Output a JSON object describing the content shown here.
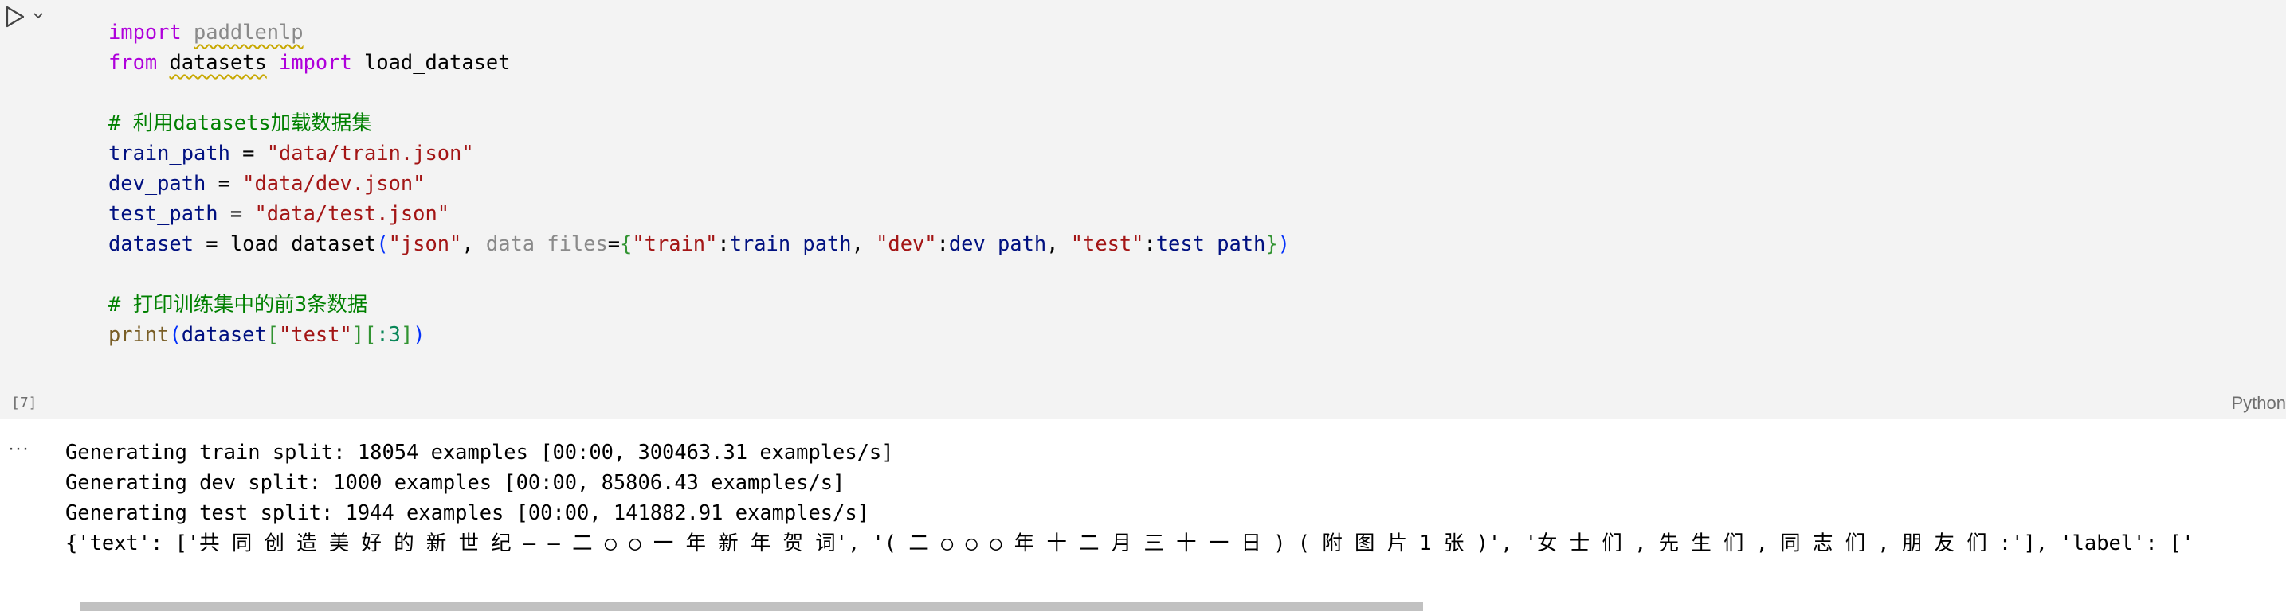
{
  "cell": {
    "execution_count": "[7]",
    "language": "Python",
    "code_lines": [
      [
        {
          "t": "import",
          "c": "kw"
        },
        {
          "t": " ",
          "c": ""
        },
        {
          "t": "paddlenlp",
          "c": "mod-unused"
        }
      ],
      [
        {
          "t": "from",
          "c": "kw"
        },
        {
          "t": " ",
          "c": ""
        },
        {
          "t": "datasets",
          "c": "mod-warn"
        },
        {
          "t": " ",
          "c": ""
        },
        {
          "t": "import",
          "c": "kw"
        },
        {
          "t": " load_dataset",
          "c": ""
        }
      ],
      [],
      [
        {
          "t": "# 利用datasets加载数据集",
          "c": "cmt"
        }
      ],
      [
        {
          "t": "train_path",
          "c": "var"
        },
        {
          "t": " = ",
          "c": ""
        },
        {
          "t": "\"data/train.json\"",
          "c": "str"
        }
      ],
      [
        {
          "t": "dev_path",
          "c": "var"
        },
        {
          "t": " = ",
          "c": ""
        },
        {
          "t": "\"data/dev.json\"",
          "c": "str"
        }
      ],
      [
        {
          "t": "test_path",
          "c": "var"
        },
        {
          "t": " = ",
          "c": ""
        },
        {
          "t": "\"data/test.json\"",
          "c": "str"
        }
      ],
      [
        {
          "t": "dataset",
          "c": "var"
        },
        {
          "t": " = ",
          "c": ""
        },
        {
          "t": "load_dataset",
          "c": ""
        },
        {
          "t": "(",
          "c": "br1"
        },
        {
          "t": "\"json\"",
          "c": "str"
        },
        {
          "t": ", ",
          "c": ""
        },
        {
          "t": "data_files",
          "c": "param"
        },
        {
          "t": "=",
          "c": ""
        },
        {
          "t": "{",
          "c": "br2"
        },
        {
          "t": "\"train\"",
          "c": "str"
        },
        {
          "t": ":",
          "c": ""
        },
        {
          "t": "train_path",
          "c": "var"
        },
        {
          "t": ", ",
          "c": ""
        },
        {
          "t": "\"dev\"",
          "c": "str"
        },
        {
          "t": ":",
          "c": ""
        },
        {
          "t": "dev_path",
          "c": "var"
        },
        {
          "t": ", ",
          "c": ""
        },
        {
          "t": "\"test\"",
          "c": "str"
        },
        {
          "t": ":",
          "c": ""
        },
        {
          "t": "test_path",
          "c": "var"
        },
        {
          "t": "}",
          "c": "br2"
        },
        {
          "t": ")",
          "c": "br1"
        }
      ],
      [],
      [
        {
          "t": "# 打印训练集中的前3条数据",
          "c": "cmt"
        }
      ],
      [
        {
          "t": "print",
          "c": "fn"
        },
        {
          "t": "(",
          "c": "br1"
        },
        {
          "t": "dataset",
          "c": "var"
        },
        {
          "t": "[",
          "c": "br2"
        },
        {
          "t": "\"test\"",
          "c": "str"
        },
        {
          "t": "]",
          "c": "br2"
        },
        {
          "t": "[",
          "c": "br2"
        },
        {
          "t": ":3",
          "c": "num"
        },
        {
          "t": "]",
          "c": "br2"
        },
        {
          "t": ")",
          "c": "br1"
        }
      ]
    ]
  },
  "output": {
    "menu_label": "···",
    "lines": [
      "Generating train split: 18054 examples [00:00, 300463.31 examples/s]",
      "Generating dev split: 1000 examples [00:00, 85806.43 examples/s]",
      "Generating test split: 1944 examples [00:00, 141882.91 examples/s]",
      "{'text': ['共 同 创 造 美 好 的 新 世 纪 — — 二 ○ ○ 一 年 新 年 贺 词', '( 二 ○ ○ ○ 年 十 二 月 三 十 一 日 ) ( 附 图 片 1 张 )', '女 士 们 , 先 生 们 , 同 志 们 , 朋 友 们 :'], 'label': ['"
    ]
  },
  "icons": {
    "run": "play-icon",
    "run_menu": "chevron-down-icon"
  },
  "colors": {
    "cell_background": "#f3f3f3",
    "keyword": "#af00db",
    "string": "#a31515",
    "comment": "#008000",
    "variable": "#001080",
    "function": "#795e26"
  }
}
